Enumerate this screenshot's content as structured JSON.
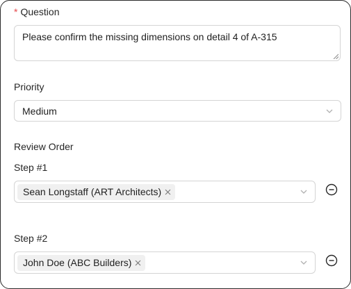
{
  "question": {
    "required_mark": "*",
    "label": "Question",
    "value": "Please confirm the missing dimensions on detail 4 of A-315"
  },
  "priority": {
    "label": "Priority",
    "selected": "Medium"
  },
  "review_order": {
    "label": "Review Order",
    "steps": [
      {
        "label": "Step #1",
        "assignee": "Sean Longstaff (ART Architects)"
      },
      {
        "label": "Step #2",
        "assignee": "John Doe (ABC Builders)"
      }
    ]
  },
  "icons": {
    "dropdown": "chevron-down-icon",
    "tag_remove": "close-icon",
    "step_remove": "minus-circle-icon"
  },
  "colors": {
    "required": "#e5484d",
    "border": "#d4d4d4",
    "tag_bg": "#f0f0f0"
  }
}
